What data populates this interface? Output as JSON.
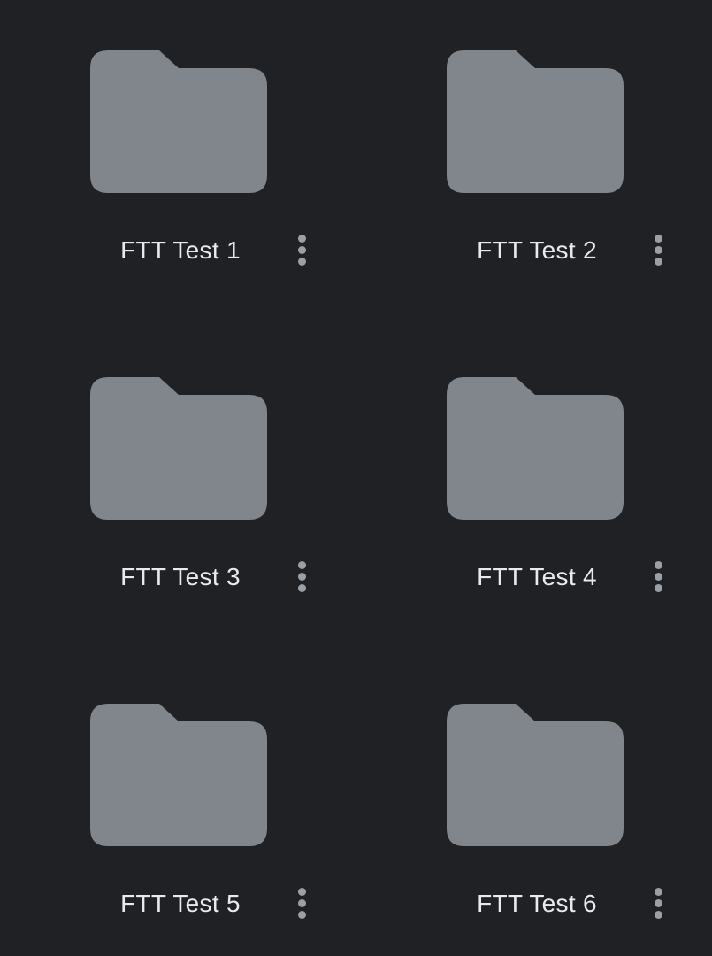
{
  "colors": {
    "background": "#202124",
    "folder": "#80868b",
    "label": "#e8eaed",
    "more_dots": "#9aa0a6"
  },
  "folders": [
    {
      "name": "FTT Test 1",
      "icon": "folder-icon",
      "menu_icon": "more-vert-icon"
    },
    {
      "name": "FTT Test 2",
      "icon": "folder-icon",
      "menu_icon": "more-vert-icon"
    },
    {
      "name": "FTT Test 3",
      "icon": "folder-icon",
      "menu_icon": "more-vert-icon"
    },
    {
      "name": "FTT Test 4",
      "icon": "folder-icon",
      "menu_icon": "more-vert-icon"
    },
    {
      "name": "FTT Test 5",
      "icon": "folder-icon",
      "menu_icon": "more-vert-icon"
    },
    {
      "name": "FTT Test 6",
      "icon": "folder-icon",
      "menu_icon": "more-vert-icon"
    }
  ]
}
